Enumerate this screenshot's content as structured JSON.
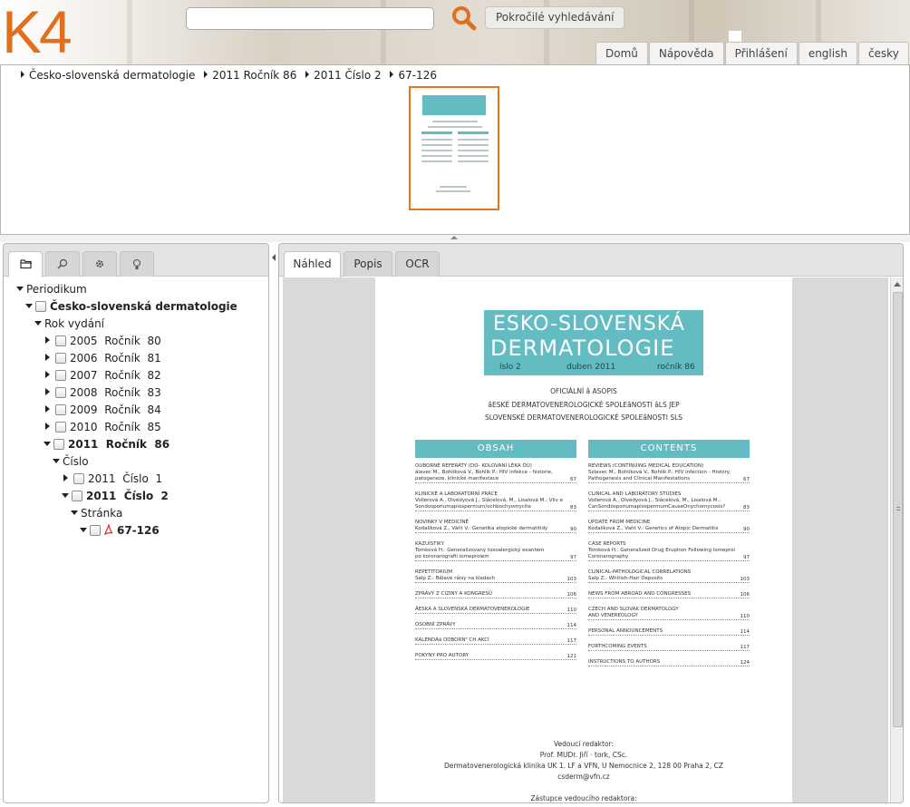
{
  "header": {
    "logo_text": "K4",
    "search": {
      "value": "",
      "placeholder": ""
    },
    "advanced_search_label": "Pokročilé vyhledávání",
    "nav_items": [
      "Domů",
      "Nápověda",
      "Přihlášení",
      "english",
      "česky"
    ],
    "colors": {
      "logo": "#e0701e",
      "search_icon": "#e0701e"
    },
    "search_icon": "magnifier-icon"
  },
  "breadcrumb": [
    "Česko-slovenská dermatologie",
    "2011 Ročník 86",
    "2011 Číslo 2",
    "67-126"
  ],
  "left_tabs": [
    {
      "icon": "folder-icon"
    },
    {
      "icon": "search-icon"
    },
    {
      "icon": "gear-icon"
    },
    {
      "icon": "lightbulb-icon"
    }
  ],
  "tree": {
    "root": "Periodikum",
    "journal": "Česko-slovenská dermatologie",
    "year_group": "Rok vydání",
    "volumes": [
      {
        "year": "2005",
        "label": "Ročník  80"
      },
      {
        "year": "2006",
        "label": "Ročník  81"
      },
      {
        "year": "2007",
        "label": "Ročník  82"
      },
      {
        "year": "2008",
        "label": "Ročník  83"
      },
      {
        "year": "2009",
        "label": "Ročník  84"
      },
      {
        "year": "2010",
        "label": "Ročník  85"
      },
      {
        "year": "2011",
        "label": "Ročník  86"
      }
    ],
    "issue_group": "Číslo",
    "issues": [
      {
        "year": "2011",
        "label": "Číslo  1"
      },
      {
        "year": "2011",
        "label": "Číslo  2"
      }
    ],
    "page_group": "Stránka",
    "page": "67-126"
  },
  "right_tabs": [
    "Náhled",
    "Popis",
    "OCR"
  ],
  "document": {
    "title_line1": "ESKO-SLOVENSKÁ",
    "title_line2": "DERMATOLOGIE",
    "issue": "íslo 2",
    "date": "duben 2011",
    "volume": "ročník 86",
    "official_lines": [
      "OFICIÁLNÍ â ASOPIS",
      "âESKÉ DERMATOVENEROLOGICKÉ SPOLEâNOSTI âLS JEP",
      "SLOVENSKÉ DERMATOVENEROLOGICKÉ SPOLEâNOSTI SLS"
    ],
    "obsah_title": "OBSAH",
    "contents_title": "CONTENTS",
    "obsah": [
      {
        "lines": [
          "OUBORNÉ REFERÁTY (DO- KOLOVANÍ LÉKA ÒÚ)",
          "álavec M., Bohlíková V., Bohlík P.: HIV infekce - historie,",
          "patogeneze, klinické manifestace"
        ],
        "page": "67"
      },
      {
        "lines": [
          "KLINICKÉ A LABORATORNÍ PRÁCE",
          "Vollerová A., Olvédyová J., Slácelová, M., Lisalová M.: Vliv e",
          "Sondosporiumapiospermum/ochbochyomycíte"
        ],
        "page": "83"
      },
      {
        "lines": [
          "NOVINKY V MEDICÍNĚ",
          "Kodalíková Z., Váňt V.: Genetika atopické dermatitidy"
        ],
        "page": "90"
      },
      {
        "lines": [
          "KAZUISTIKY",
          "Tomková H.: Generalizovaný toxoalergický exantém",
          "po koronarografii iomeprolem"
        ],
        "page": "97"
      },
      {
        "lines": [
          "REPETITORIUM",
          "Salp Z.: Bělavé ráisy na kladach"
        ],
        "page": "103"
      },
      {
        "lines": [
          "ZPRÁVY Z CIZINY A KONGRESÛ"
        ],
        "page": "106"
      },
      {
        "lines": [
          "ÂESKÁ A SLOVENSKÁ DERMATOVENEROLOGIE"
        ],
        "page": "110"
      },
      {
        "lines": [
          "OSOBNÍ ZPRÁVY"
        ],
        "page": "114"
      },
      {
        "lines": [
          "KALENDÁã ODBORN² CH AKCÍ"
        ],
        "page": "117"
      },
      {
        "lines": [
          "POKYNY PRO AUTORY"
        ],
        "page": "121"
      }
    ],
    "contents": [
      {
        "lines": [
          "REVIEWS (CONTINUING MEDICAL EDUCATION)",
          "Szlavec M., Bohlíková V., Bohlík P.: HIV infection - History,",
          "Pathogenesis and Clinical Manifestations"
        ],
        "page": "67"
      },
      {
        "lines": [
          "CLINICAL AND LABORATORY STUDIES",
          "Vollerová A., Olvédyová J., Slácelová, M., Lisalová M.:",
          "CanSondosporiumapiospermumCauseOnychomycosis?"
        ],
        "page": "83"
      },
      {
        "lines": [
          "UPDATE FROM MEDICINE",
          "Kodalíková Z., Vaňt V.: Genetics of Atopic Dermatitis"
        ],
        "page": "90"
      },
      {
        "lines": [
          "CASE REPORTS",
          "Tomková H.: Generalized Drug Eruption Following Iomeprol",
          "Coronarography"
        ],
        "page": "97"
      },
      {
        "lines": [
          "CLINICAL-PATHOLOGICAL CORRELATIONS",
          "Salp Z.: Whitish-Hair Deposits"
        ],
        "page": "103"
      },
      {
        "lines": [
          "NEWS FROM ABROAD AND CONGRESSES"
        ],
        "page": "106"
      },
      {
        "lines": [
          "CZECH AND SLOVAK DERMATOLOGY",
          "AND VENEREOLOGY"
        ],
        "page": "110"
      },
      {
        "lines": [
          "PERSONAL ANNOUNCEMENTS"
        ],
        "page": "114"
      },
      {
        "lines": [
          "FORTHCOMING EVENTS"
        ],
        "page": "117"
      },
      {
        "lines": [
          "INSTRUCTIONS TO AUTHORS"
        ],
        "page": "124"
      }
    ],
    "footer_lines": [
      "Vedoucí redaktor:",
      "Prof. MUDr. Jiří · tork, CSc.",
      "Dermatovenerologická klinika UK 1. LF a VFN, U Nemocnice 2, 128 00 Praha 2, CZ",
      "csderm@vfn.cz",
      "",
      "Zástupce vedoucího redaktora:"
    ],
    "colors": {
      "accent": "#63bcc2",
      "thumbnail_border": "#e57320"
    }
  }
}
